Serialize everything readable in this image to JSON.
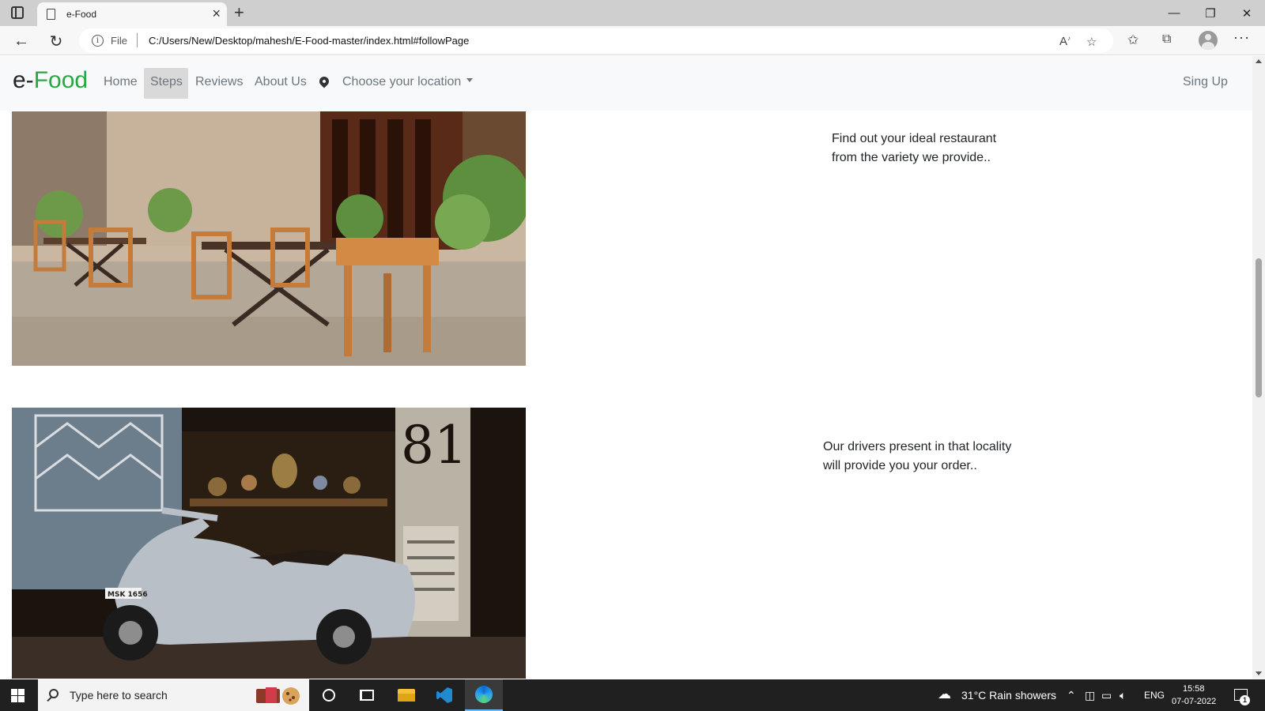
{
  "browser": {
    "tab_title": "e-Food",
    "url_scheme": "File",
    "url": "C:/Users/New/Desktop/mahesh/E-Food-master/index.html#followPage",
    "icons": [
      "sidebar-icon",
      "page-icon",
      "close-icon",
      "plus-icon",
      "minimize-icon",
      "restore-icon",
      "back-icon",
      "refresh-icon",
      "info-icon",
      "read-aloud-icon",
      "add-favorite-icon",
      "favorites-icon",
      "collections-icon",
      "profile-icon",
      "more-icon"
    ]
  },
  "site": {
    "brand_prefix": "e-",
    "brand_name": "Food",
    "brand_color": "#28a745",
    "nav": [
      "Home",
      "Steps",
      "Reviews",
      "About Us"
    ],
    "active_nav": "Steps",
    "location_dropdown": "Choose your location",
    "signup": "Sing Up"
  },
  "steps": [
    {
      "image": "outdoor restaurant patio with wooden tables and chairs",
      "text_line1": "Find out your ideal restaurant",
      "text_line2": "from the variety we provide.."
    },
    {
      "image": "vintage silver scooter parked in front of a shop",
      "text_line1": "Our drivers present in that locality",
      "text_line2": "will provide you your order.."
    }
  ],
  "taskbar": {
    "search_placeholder": "Type here to search",
    "weather": "31°C  Rain showers",
    "language": "ENG",
    "time": "15:58",
    "date": "07-07-2022",
    "notification_count": "1"
  }
}
